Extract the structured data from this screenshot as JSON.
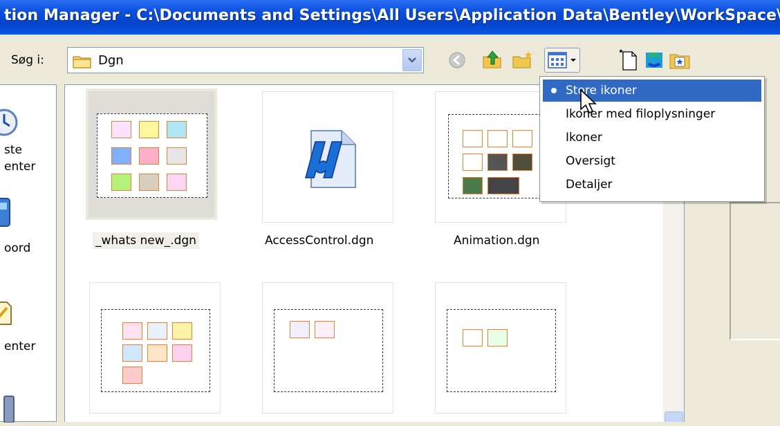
{
  "window": {
    "title": "tion Manager - C:\\Documents and Settings\\All Users\\Application Data\\Bentley\\WorkSpace\\P"
  },
  "toolbar": {
    "look_in_label": "Søg i:",
    "look_in_value": "Dgn",
    "icons": [
      "back-icon",
      "up-folder-icon",
      "new-folder-icon",
      "views-menu-icon",
      "new-file-icon",
      "refresh-icon",
      "folder-star-icon"
    ]
  },
  "places_bar": {
    "labels": [
      "ste",
      "enter",
      "oord",
      "enter"
    ]
  },
  "files": [
    {
      "name": "_whats new_.dgn",
      "selected": true,
      "thumb": "grid"
    },
    {
      "name": "AccessControl.dgn",
      "selected": false,
      "thumb": "microstation"
    },
    {
      "name": "Animation.dgn",
      "selected": false,
      "thumb": "grid"
    },
    {
      "name": "",
      "selected": false,
      "thumb": "grid"
    },
    {
      "name": "",
      "selected": false,
      "thumb": "grid"
    },
    {
      "name": "",
      "selected": false,
      "thumb": "grid"
    }
  ],
  "view_menu": {
    "items": [
      {
        "label": "Store ikoner",
        "selected": true
      },
      {
        "label": "Ikoner med filoplysninger",
        "selected": false
      },
      {
        "label": "Ikoner",
        "selected": false
      },
      {
        "label": "Oversigt",
        "selected": false
      },
      {
        "label": "Detaljer",
        "selected": false
      }
    ]
  },
  "colors": {
    "titlebar": "#0a4fdc",
    "menu_highlight": "#316ac5",
    "dialog_bg": "#ece9d8",
    "cell_border": "#f08030"
  }
}
